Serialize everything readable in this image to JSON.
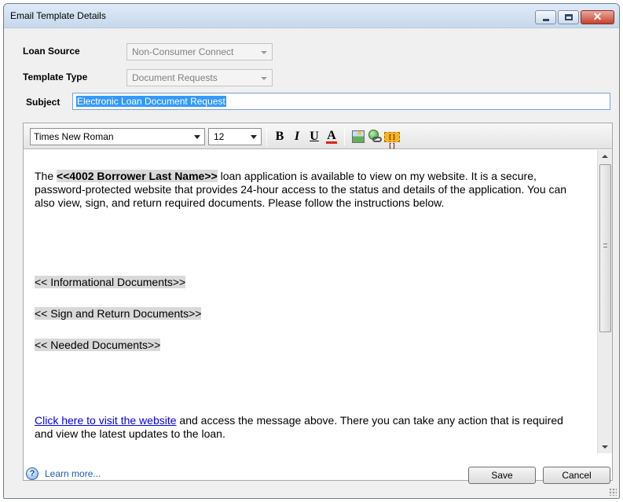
{
  "window": {
    "title": "Email Template Details",
    "controls": {
      "minimize": "minimize-icon",
      "maximize": "maximize-icon",
      "close": "close-icon",
      "close_glyph": "✕"
    }
  },
  "form": {
    "loan_source": {
      "label": "Loan Source",
      "value": "Non-Consumer Connect",
      "disabled": true
    },
    "template_type": {
      "label": "Template Type",
      "value": "Document Requests",
      "disabled": true
    },
    "subject": {
      "label": "Subject",
      "value": "Electronic Loan Document Request"
    }
  },
  "toolbar": {
    "font_family": "Times New Roman",
    "font_size": "12",
    "bold_label": "B",
    "italic_label": "I",
    "underline_label": "U",
    "font_color_label": "A",
    "font_color": "#d9261c",
    "insert_field_label": "[][]"
  },
  "body": {
    "intro_prefix": "The ",
    "intro_field": "<<4002 Borrower Last Name>>",
    "intro_text": " loan application is available to view on my website. It is a secure, password-protected website that provides 24-hour access to the status and details of the application. You can also view, sign, and return required documents. Please follow the instructions below.",
    "informational_docs": "<< Informational Documents>>",
    "sign_return_docs": "<< Sign and Return Documents>>",
    "needed_docs": "<< Needed Documents>>",
    "link_text": "Click here to visit the website",
    "closing_text": " and access the message above. There you can take any action that is required and view the latest updates to the loan."
  },
  "footer": {
    "help_glyph": "?",
    "learn_more": "Learn more...",
    "save_label": "Save",
    "cancel_label": "Cancel"
  },
  "colors": {
    "selection": "#3399ff",
    "link": "#0000ee",
    "merge_field_bg": "#d9d9d9",
    "learn_more": "#1e5bb8"
  }
}
